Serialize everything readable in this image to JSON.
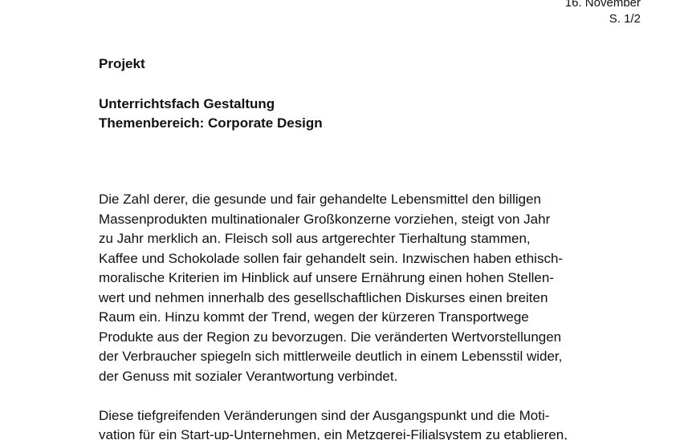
{
  "header": {
    "date": "16. November",
    "page": "S. 1/2"
  },
  "document": {
    "project_label": "Projekt",
    "subject": "Unterrichtsfach Gestaltung",
    "topic": "Themenbereich: Corporate Design",
    "paragraphs": [
      {
        "lines": [
          "Die Zahl derer, die gesunde und fair gehandelte Lebensmittel den billigen",
          "Massenprodukten multinationaler Großkonzerne vorziehen, steigt von Jahr",
          "zu Jahr merklich an. Fleisch soll aus artgerechter Tierhaltung stammen,",
          "Kaffee und Schokolade sollen fair gehandelt sein. Inzwischen haben ethisch-",
          "moralische Kriterien im Hinblick auf unsere Ernährung einen hohen Stellen-",
          "wert und nehmen innerhalb des gesellschaftlichen Diskurses einen breiten",
          "Raum ein. Hinzu kommt der Trend, wegen der kürzeren Transportwege",
          "Produkte aus der Region zu bevorzugen. Die veränderten Wertvorstellungen",
          "der Verbraucher spiegeln sich mittlerweile deutlich in einem Lebensstil wider,",
          "der Genuss mit sozialer Verantwortung verbindet."
        ]
      },
      {
        "lines": [
          "Diese tiefgreifenden Veränderungen sind der Ausgangspunkt und die Moti-",
          "vation für ein Start-up-Unternehmen, ein Metzgerei-Filialsystem zu etablieren,"
        ]
      }
    ]
  }
}
